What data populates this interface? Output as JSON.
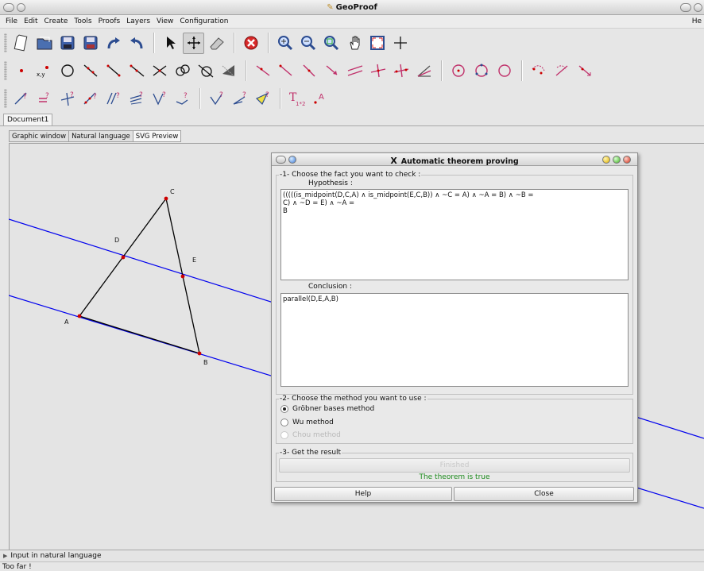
{
  "app": {
    "title": "GeoProof"
  },
  "menu": {
    "items": [
      "File",
      "Edit",
      "Create",
      "Tools",
      "Proofs",
      "Layers",
      "View",
      "Configuration"
    ],
    "right_item": "He"
  },
  "toolbars": {
    "row1": [
      "new-icon",
      "open-icon",
      "save-icon",
      "save-as-icon",
      "redo-icon",
      "undo-icon",
      "pointer-icon",
      "move-icon",
      "eraser-icon",
      "delete-icon",
      "zoom-in-icon",
      "zoom-out-icon",
      "zoom-fit-icon",
      "hand-icon",
      "fit-window-icon",
      "center-icon"
    ],
    "row2_label_point_coords": "x,y",
    "row3_labels": {
      "text_tool": "T",
      "text_tool_sub": "1*2",
      "label_tool": "A"
    }
  },
  "document": {
    "tab": "Document1"
  },
  "view_tabs": [
    "Graphic window",
    "Natural language",
    "SVG Preview"
  ],
  "figure": {
    "points": {
      "A": "A",
      "B": "B",
      "C": "C",
      "D": "D",
      "E": "E"
    },
    "colors": {
      "line": "#0000ee",
      "segment": "#000000",
      "point": "#cc0000"
    }
  },
  "dialog": {
    "title": "Automatic theorem proving",
    "step1": "-1- Choose the fact you want to check :",
    "hypothesis_label": "Hypothesis :",
    "hypothesis_text": "(((((is_midpoint(D,C,A) ∧ is_midpoint(E,C,B)) ∧ ~C = A) ∧ ~A = B) ∧ ~B =\nC) ∧ ~D = E) ∧ ~A =\nB",
    "conclusion_label": "Conclusion :",
    "conclusion_text": "parallel(D,E,A,B)",
    "step2": "-2- Choose the method you want to use :",
    "methods": [
      {
        "label": "Gröbner bases method",
        "selected": true,
        "enabled": true
      },
      {
        "label": "Wu method",
        "selected": false,
        "enabled": true
      },
      {
        "label": "Chou method",
        "selected": false,
        "enabled": false
      }
    ],
    "step3": "-3- Get the result",
    "finished_button": "Finished",
    "result": "The theorem is true",
    "result_color": "#1c8a1c",
    "help_button": "Help",
    "close_button": "Close"
  },
  "bottom": {
    "natural_language_toggle": "Input in natural language"
  },
  "status": {
    "message": "Too far !"
  }
}
